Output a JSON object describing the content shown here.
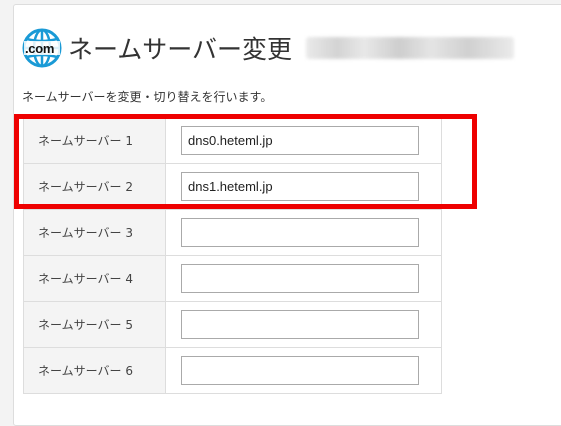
{
  "header": {
    "logo_text": ".com",
    "title": "ネームサーバー変更"
  },
  "description": "ネームサーバーを変更・切り替えを行います。",
  "nameservers": [
    {
      "label": "ネームサーバー 1",
      "value": "dns0.heteml.jp"
    },
    {
      "label": "ネームサーバー 2",
      "value": "dns1.heteml.jp"
    },
    {
      "label": "ネームサーバー 3",
      "value": ""
    },
    {
      "label": "ネームサーバー 4",
      "value": ""
    },
    {
      "label": "ネームサーバー 5",
      "value": ""
    },
    {
      "label": "ネームサーバー 6",
      "value": ""
    }
  ],
  "colors": {
    "highlight": "#ee0000",
    "logo_globe": "#1a9ad6"
  },
  "icons": {
    "logo": "globe-icon"
  }
}
